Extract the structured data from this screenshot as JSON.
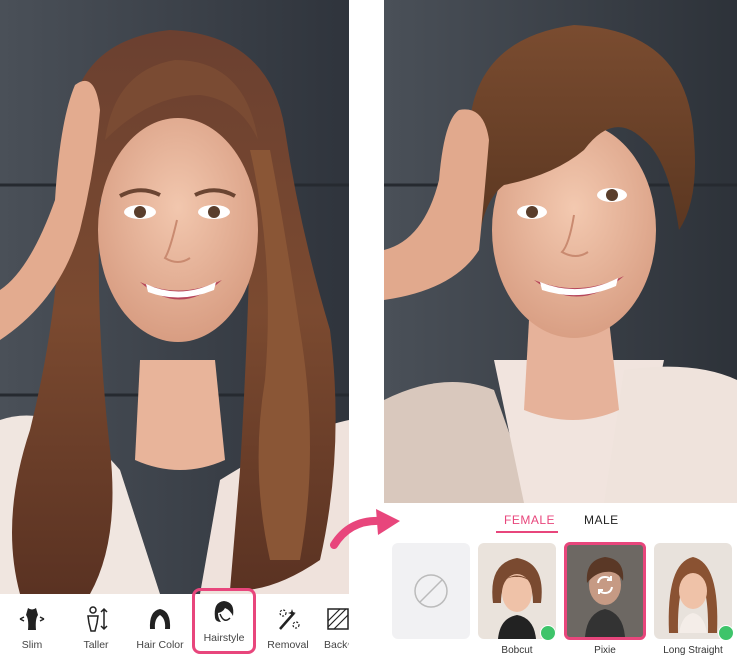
{
  "left_toolbar": {
    "items": [
      {
        "label": "Slim",
        "icon": "slim-icon"
      },
      {
        "label": "Taller",
        "icon": "taller-icon"
      },
      {
        "label": "Hair Color",
        "icon": "hair-color-icon"
      },
      {
        "label": "Hairstyle",
        "icon": "hairstyle-icon",
        "active": true
      },
      {
        "label": "Removal",
        "icon": "removal-icon"
      },
      {
        "label": "Backg",
        "icon": "background-icon"
      }
    ]
  },
  "hairstyle_panel": {
    "tabs": {
      "female": "FEMALE",
      "male": "MALE"
    },
    "active_tab": "FEMALE",
    "styles": [
      {
        "label": "",
        "icon": "none-icon"
      },
      {
        "label": "Bobcut",
        "checked": true
      },
      {
        "label": "Pixie",
        "selected": true,
        "icon": "swap-icon"
      },
      {
        "label": "Long Straight",
        "checked": true
      }
    ]
  },
  "colors": {
    "accent": "#e8467c",
    "check": "#3ec46a",
    "wall": "#3f454e"
  }
}
